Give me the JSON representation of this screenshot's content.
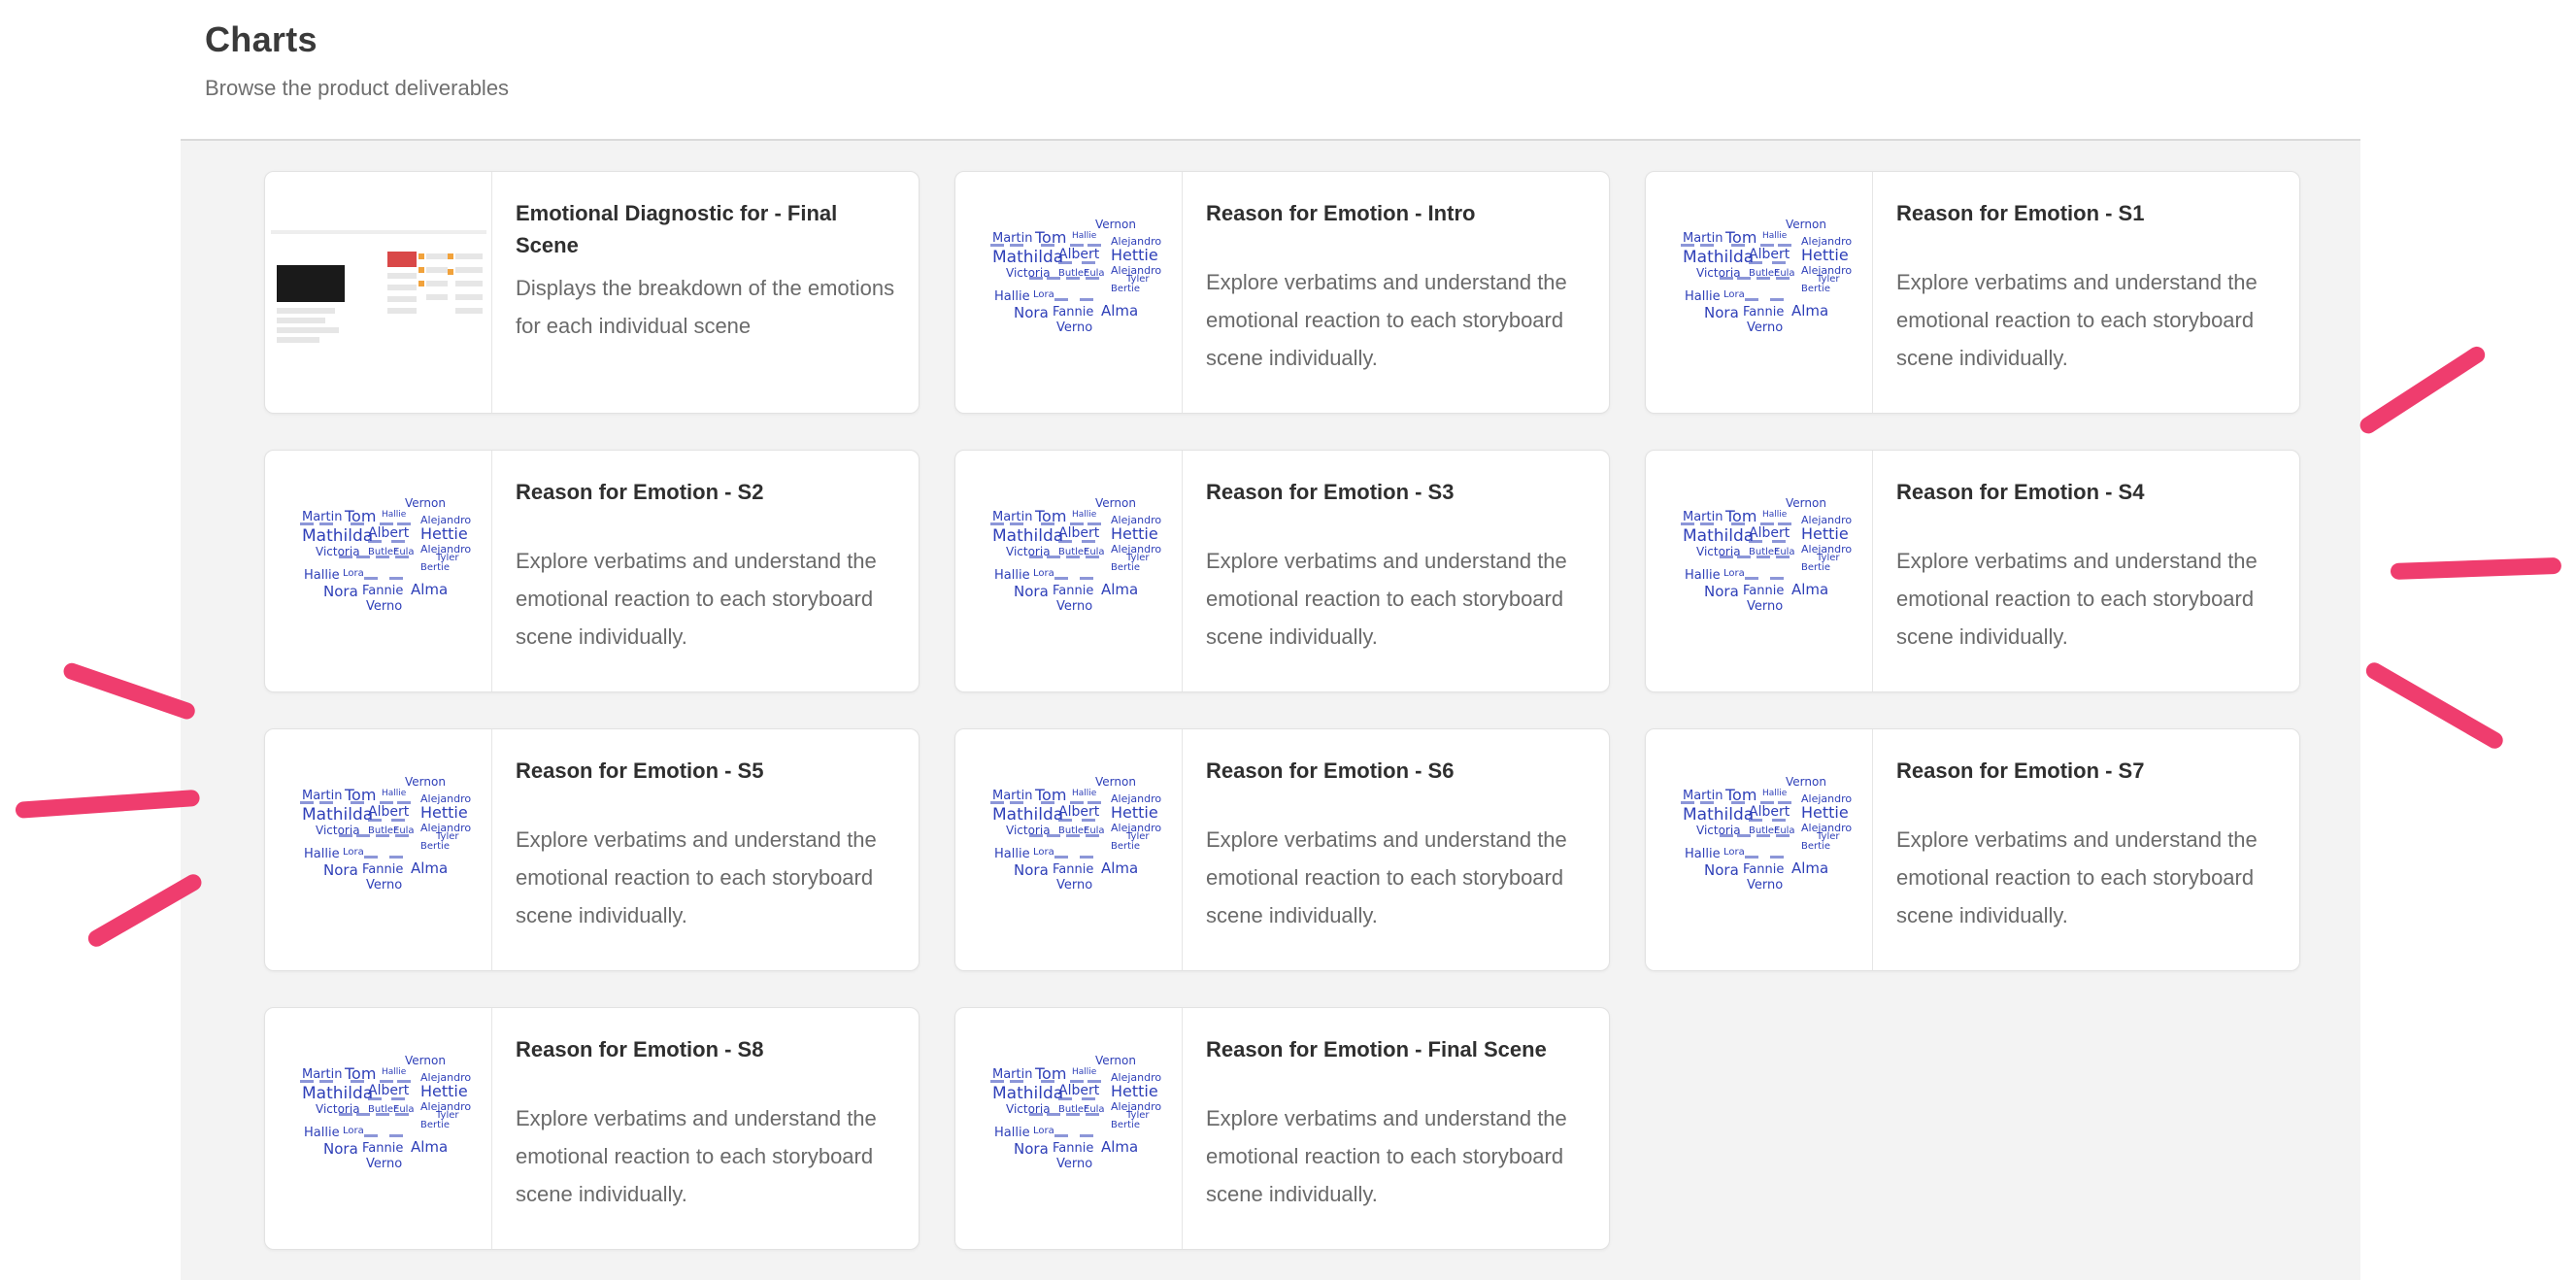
{
  "header": {
    "title": "Charts",
    "subtitle": "Browse the product deliverables"
  },
  "cards": [
    {
      "title": "Emotional Diagnostic for - Final Scene",
      "description": "Displays the breakdown of the emotions for each individual scene",
      "thumbnail": "diagnostic-screenshot"
    },
    {
      "title": "Reason for Emotion - Intro",
      "description": "Explore verbatims and understand the emotional reaction to each storyboard scene individually.",
      "thumbnail": "word-cloud"
    },
    {
      "title": "Reason for Emotion - S1",
      "description": "Explore verbatims and understand the emotional reaction to each storyboard scene individually.",
      "thumbnail": "word-cloud"
    },
    {
      "title": "Reason for Emotion - S2",
      "description": "Explore verbatims and understand the emotional reaction to each storyboard scene individually.",
      "thumbnail": "word-cloud"
    },
    {
      "title": "Reason for Emotion - S3",
      "description": "Explore verbatims and understand the emotional reaction to each storyboard scene individually.",
      "thumbnail": "word-cloud"
    },
    {
      "title": "Reason for Emotion - S4",
      "description": "Explore verbatims and understand the emotional reaction to each storyboard scene individually.",
      "thumbnail": "word-cloud"
    },
    {
      "title": "Reason for Emotion - S5",
      "description": "Explore verbatims and understand the emotional reaction to each storyboard scene individually.",
      "thumbnail": "word-cloud"
    },
    {
      "title": "Reason for Emotion - S6",
      "description": "Explore verbatims and understand the emotional reaction to each storyboard scene individually.",
      "thumbnail": "word-cloud"
    },
    {
      "title": "Reason for Emotion - S7",
      "description": "Explore verbatims and understand the emotional reaction to each storyboard scene individually.",
      "thumbnail": "word-cloud"
    },
    {
      "title": "Reason for Emotion - S8",
      "description": "Explore verbatims and understand the emotional reaction to each storyboard scene individually.",
      "thumbnail": "word-cloud"
    },
    {
      "title": "Reason for Emotion - Final Scene",
      "description": "Explore verbatims and understand the emotional reaction to each storyboard scene individually.",
      "thumbnail": "word-cloud"
    }
  ],
  "word_cloud_words": [
    "Vernon",
    "Martin",
    "Tom",
    "Hallie",
    "Alejandro",
    "Mathilda",
    "Albert",
    "Hettie",
    "Victoria",
    "Alejandro",
    "Butler",
    "Eula",
    "Tyler",
    "Bertie",
    "Hallie",
    "Lora",
    "Nora",
    "Fannie",
    "Alma",
    "Verno"
  ],
  "colors": {
    "word_cloud": "#2e3fb8",
    "annotation_stroke": "#ef3d6e",
    "panel_background": "#f3f3f3"
  }
}
